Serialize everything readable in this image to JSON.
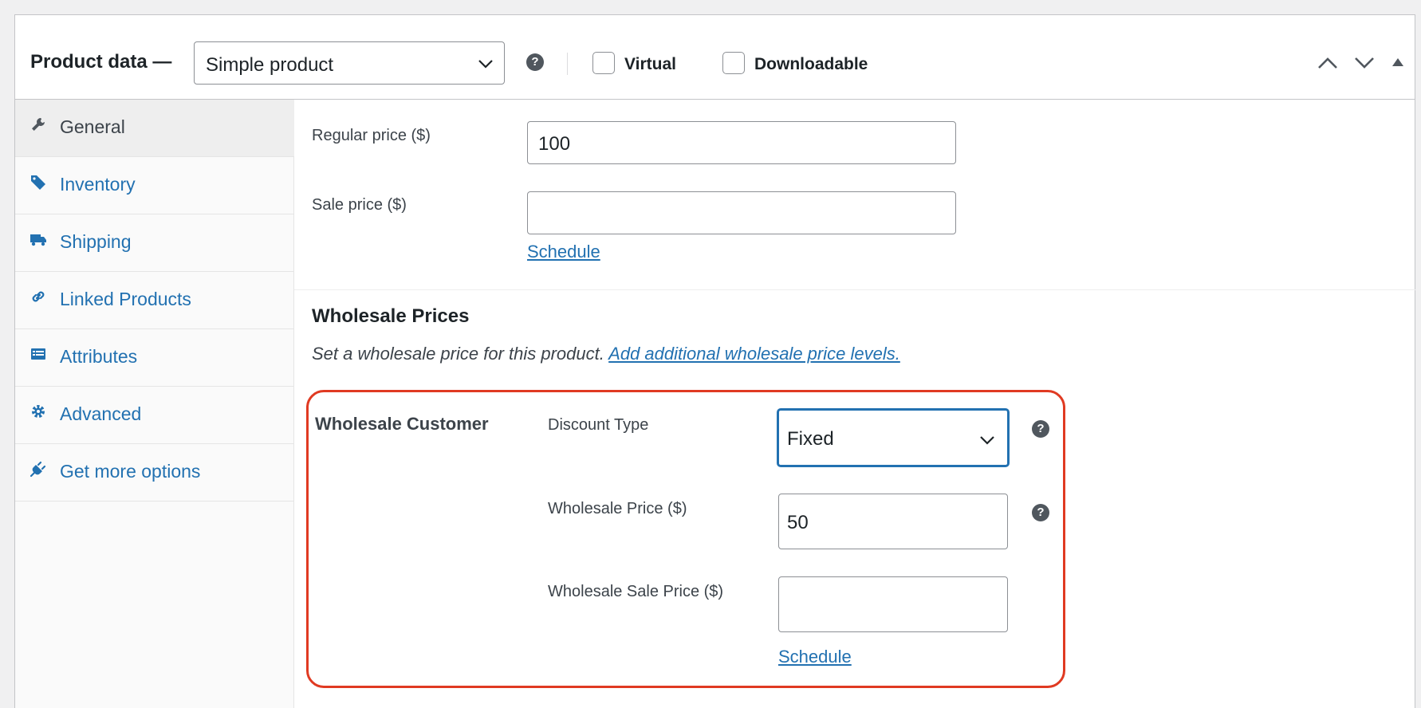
{
  "header": {
    "title": "Product data —",
    "product_type": "Simple product",
    "virtual_label": "Virtual",
    "downloadable_label": "Downloadable"
  },
  "sidebar": {
    "items": [
      {
        "label": "General",
        "icon": "wrench-icon",
        "active": true
      },
      {
        "label": "Inventory",
        "icon": "tag-icon"
      },
      {
        "label": "Shipping",
        "icon": "truck-icon"
      },
      {
        "label": "Linked Products",
        "icon": "link-icon"
      },
      {
        "label": "Attributes",
        "icon": "list-icon"
      },
      {
        "label": "Advanced",
        "icon": "gear-icon"
      },
      {
        "label": "Get more options",
        "icon": "plugin-icon"
      }
    ]
  },
  "pricing": {
    "regular_price_label": "Regular price ($)",
    "regular_price_value": "100",
    "sale_price_label": "Sale price ($)",
    "sale_price_value": "",
    "schedule_link": "Schedule"
  },
  "wholesale": {
    "title": "Wholesale Prices",
    "description": "Set a wholesale price for this product.",
    "description_link": "Add additional wholesale price levels.",
    "role_label": "Wholesale Customer",
    "discount_type_label": "Discount Type",
    "discount_type_value": "Fixed",
    "wholesale_price_label": "Wholesale Price ($)",
    "wholesale_price_value": "50",
    "wholesale_sale_price_label": "Wholesale Sale Price ($)",
    "wholesale_sale_price_value": "",
    "schedule_link": "Schedule"
  },
  "colors": {
    "link": "#2271b1",
    "highlight": "#e03a22",
    "focus": "#2271b1"
  }
}
